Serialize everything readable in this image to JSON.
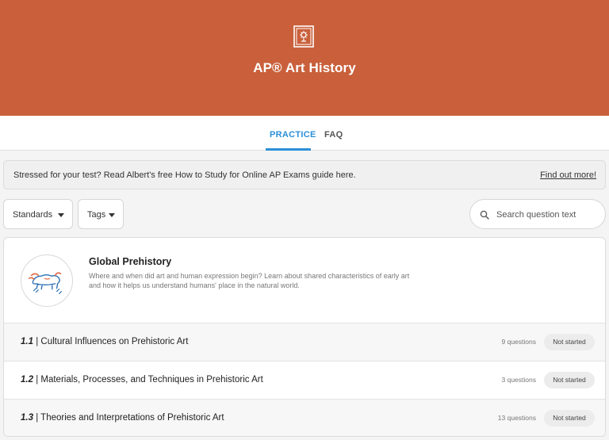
{
  "header": {
    "title": "AP® Art History",
    "brand_color": "#c9603b",
    "icon": "framed-painting-icon"
  },
  "tabs": [
    {
      "label": "PRACTICE",
      "active": true
    },
    {
      "label": "FAQ",
      "active": false
    }
  ],
  "banner": {
    "text": "Stressed for your test? Read Albert's free How to Study for Online AP Exams guide here.",
    "link": "Find out more!"
  },
  "filters": {
    "standards_label": "Standards",
    "tags_label": "Tags"
  },
  "search": {
    "placeholder": "Search question text",
    "value": ""
  },
  "unit": {
    "title": "Global Prehistory",
    "description": "Where and when did art and human expression begin? Learn about shared characteristics of early art and how it helps us understand humans' place in the natural world.",
    "icon": "cave-painting-bison-icon"
  },
  "topics": [
    {
      "number": "1.1",
      "title": "| Cultural Influences on Prehistoric Art",
      "count": "9 questions",
      "status": "Not started"
    },
    {
      "number": "1.2",
      "title": "| Materials, Processes, and Techniques in Prehistoric Art",
      "count": "3 questions",
      "status": "Not started"
    },
    {
      "number": "1.3",
      "title": "| Theories and Interpretations of Prehistoric Art",
      "count": "13 questions",
      "status": "Not started"
    }
  ]
}
